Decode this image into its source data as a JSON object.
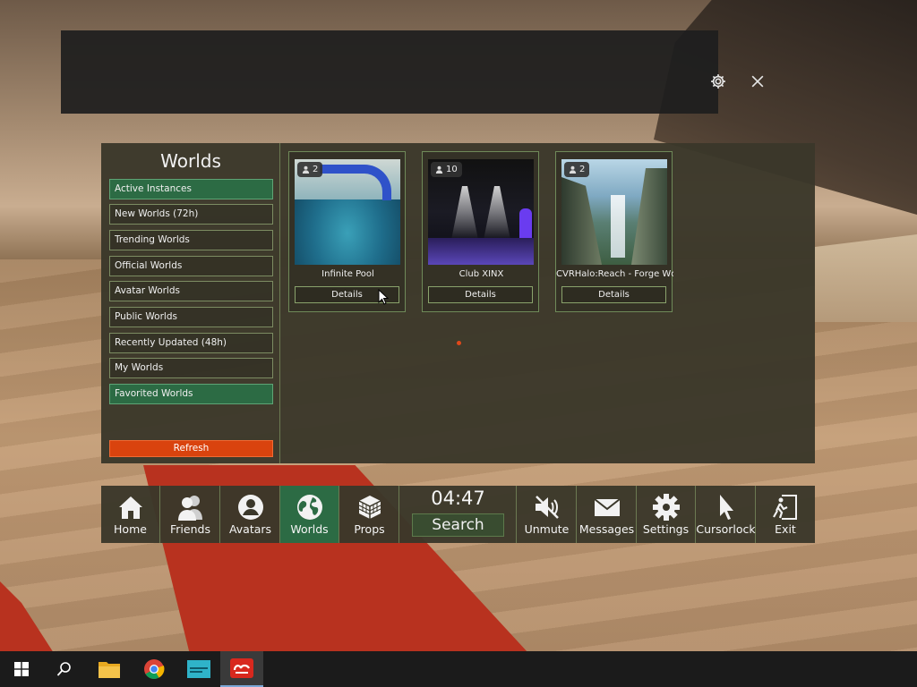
{
  "top_panel": {
    "icons": [
      "gear-icon",
      "close-icon"
    ]
  },
  "worlds": {
    "title": "Worlds",
    "categories": [
      {
        "label": "Active Instances",
        "active": true
      },
      {
        "label": "New Worlds (72h)",
        "active": false
      },
      {
        "label": "Trending Worlds",
        "active": false
      },
      {
        "label": "Official Worlds",
        "active": false
      },
      {
        "label": "Avatar Worlds",
        "active": false
      },
      {
        "label": "Public Worlds",
        "active": false
      },
      {
        "label": "Recently Updated (48h)",
        "active": false
      },
      {
        "label": "My Worlds",
        "active": false
      },
      {
        "label": "Favorited Worlds",
        "active": true
      }
    ],
    "refresh_label": "Refresh",
    "cards": [
      {
        "name": "Infinite Pool",
        "players": "2",
        "details_label": "Details"
      },
      {
        "name": "Club XINX",
        "players": "10",
        "details_label": "Details"
      },
      {
        "name": "CVRHalo:Reach - Forge Wc",
        "players": "2",
        "details_label": "Details"
      }
    ]
  },
  "menu": {
    "items": [
      {
        "label": "Home",
        "icon": "home-icon"
      },
      {
        "label": "Friends",
        "icon": "friends-icon"
      },
      {
        "label": "Avatars",
        "icon": "avatar-icon"
      },
      {
        "label": "Worlds",
        "icon": "globe-icon",
        "active": true
      },
      {
        "label": "Props",
        "icon": "cube-icon"
      },
      {
        "label": "Unmute",
        "icon": "speaker-muted-icon"
      },
      {
        "label": "Messages",
        "icon": "envelope-icon"
      },
      {
        "label": "Settings",
        "icon": "gear-icon"
      },
      {
        "label": "Cursorlock",
        "icon": "cursor-icon"
      },
      {
        "label": "Exit",
        "icon": "exit-icon"
      }
    ],
    "clock": "04:47",
    "search_label": "Search"
  },
  "taskbar": {
    "items": [
      "windows-start-icon",
      "search-icon",
      "file-explorer-icon",
      "chrome-icon",
      "app-icon",
      "chilloutvr-icon"
    ]
  },
  "colors": {
    "accent_green": "#2c6b44",
    "refresh_orange": "#d9430e",
    "panel_bg": "#3a372a"
  }
}
